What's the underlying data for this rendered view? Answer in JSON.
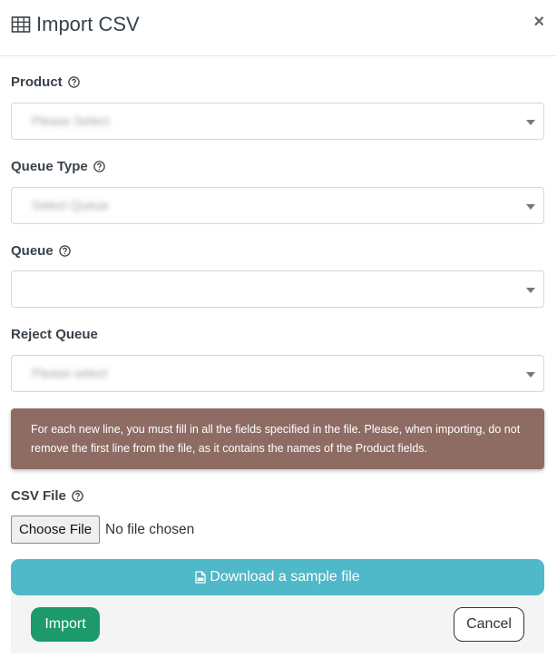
{
  "modal": {
    "title": "Import CSV",
    "title_icon": "table-icon",
    "close_label": "×"
  },
  "fields": [
    {
      "label": "Product",
      "has_help": true,
      "value": "Please Select"
    },
    {
      "label": "Queue Type",
      "has_help": true,
      "value": "Select Queue"
    },
    {
      "label": "Queue",
      "has_help": true,
      "value": ""
    },
    {
      "label": "Reject Queue",
      "has_help": false,
      "value": "Please select"
    }
  ],
  "alert": {
    "text": "For each new line, you must fill in all the fields specified in the file. Please, when importing, do not remove the first line from the file, as it contains the names of the Product fields.",
    "color": "#8e6c64"
  },
  "csv": {
    "label": "CSV File",
    "choose_button": "Choose File",
    "status": "No file chosen"
  },
  "download": {
    "label": "Download a sample file",
    "icon": "file-csv-icon",
    "color": "#4fb8c9"
  },
  "footer": {
    "import_label": "Import",
    "cancel_label": "Cancel",
    "import_color": "#1d9a6c"
  }
}
